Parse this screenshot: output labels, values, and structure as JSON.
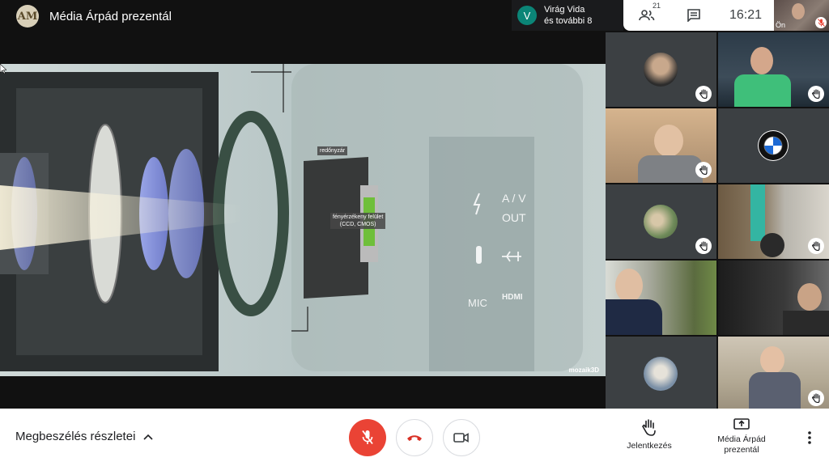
{
  "header": {
    "presenter_initials": "AM",
    "presenter_title": "Média Árpád prezentál"
  },
  "participants_pill": {
    "avatar_letter": "V",
    "name": "Virág Vida",
    "others": "és további 8"
  },
  "controls": {
    "people_count": "21",
    "clock": "16:21"
  },
  "self_view": {
    "label": "Ön"
  },
  "presentation": {
    "label_shutter": "redőnyzár",
    "label_sensor_line1": "fényérzékeny felület",
    "label_sensor_line2": "(CCD, CMOS)",
    "label_av": "A / V",
    "label_out": "OUT",
    "label_mic": "MIC",
    "label_hdmi": "HDMI",
    "watermark": "mozaik3D"
  },
  "tiles": [
    {
      "name": "tile-1",
      "raised_hand": true
    },
    {
      "name": "tile-2",
      "raised_hand": true
    },
    {
      "name": "tile-3",
      "raised_hand": true
    },
    {
      "name": "tile-4",
      "raised_hand": false,
      "logo": "BMW"
    },
    {
      "name": "tile-5",
      "raised_hand": true
    },
    {
      "name": "tile-6",
      "raised_hand": true
    },
    {
      "name": "tile-7",
      "raised_hand": false
    },
    {
      "name": "tile-8",
      "raised_hand": false
    },
    {
      "name": "tile-9",
      "raised_hand": false
    },
    {
      "name": "tile-10",
      "raised_hand": true
    }
  ],
  "bottombar": {
    "meeting_details": "Megbeszélés részletei",
    "raise_hand_label": "Jelentkezés",
    "present_label_line1": "Média Árpád",
    "present_label_line2": "prezentál"
  },
  "colors": {
    "mic_red": "#ea4335",
    "hangup_red": "#d93025",
    "bmw_blue": "#1c69d4"
  }
}
